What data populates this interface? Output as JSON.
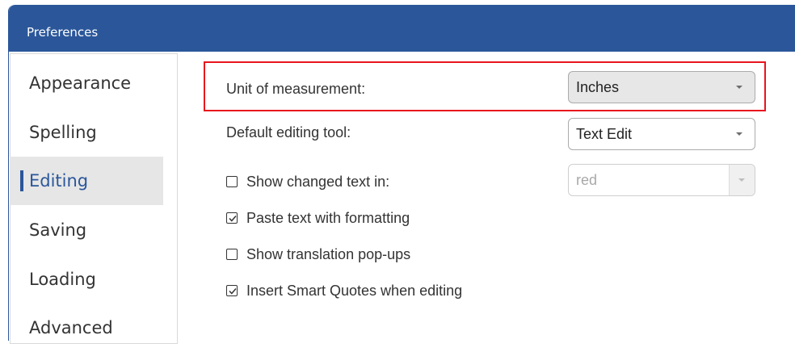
{
  "window": {
    "title": "Preferences"
  },
  "sidebar": {
    "items": [
      {
        "label": "Appearance",
        "selected": false
      },
      {
        "label": "Spelling",
        "selected": false
      },
      {
        "label": "Editing",
        "selected": true
      },
      {
        "label": "Saving",
        "selected": false
      },
      {
        "label": "Loading",
        "selected": false
      },
      {
        "label": "Advanced",
        "selected": false
      }
    ]
  },
  "editing": {
    "unit_label": "Unit of measurement:",
    "unit_value": "Inches",
    "tool_label": "Default editing tool:",
    "tool_value": "Text Edit",
    "changed_text_label": "Show changed text in:",
    "changed_text_checked": false,
    "changed_text_color": "red",
    "paste_label": "Paste text with formatting",
    "paste_checked": true,
    "translation_label": "Show translation pop-ups",
    "translation_checked": false,
    "quotes_label": "Insert Smart Quotes when editing",
    "quotes_checked": true
  },
  "colors": {
    "accent": "#2b579a",
    "highlight_border": "#e8141e"
  }
}
